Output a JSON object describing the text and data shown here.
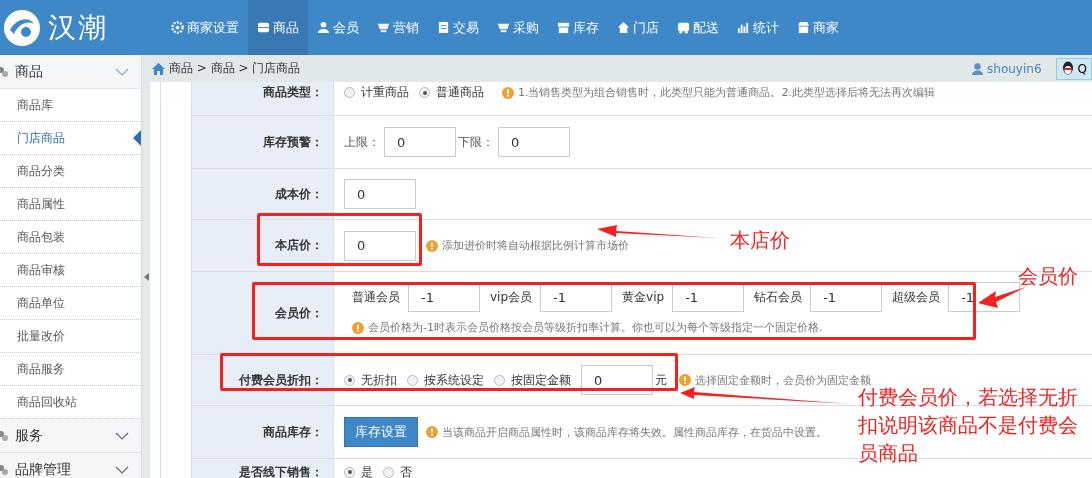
{
  "logo": {
    "text": "汉潮"
  },
  "nav": [
    {
      "label": "商家设置",
      "selected": false
    },
    {
      "label": "商品",
      "selected": true
    },
    {
      "label": "会员",
      "selected": false
    },
    {
      "label": "营销",
      "selected": false
    },
    {
      "label": "交易",
      "selected": false
    },
    {
      "label": "采购",
      "selected": false
    },
    {
      "label": "库存",
      "selected": false
    },
    {
      "label": "门店",
      "selected": false
    },
    {
      "label": "配送",
      "selected": false
    },
    {
      "label": "统计",
      "selected": false
    },
    {
      "label": "商家",
      "selected": false
    }
  ],
  "breadcrumb": "商品 > 商品 > 门店商品",
  "user": {
    "name": "shouyin6",
    "qq": "Q"
  },
  "sidebar": [
    {
      "label": "商品",
      "expanded": true,
      "items": [
        {
          "label": "商品库",
          "selected": false
        },
        {
          "label": "门店商品",
          "selected": true
        },
        {
          "label": "商品分类",
          "selected": false
        },
        {
          "label": "商品属性",
          "selected": false
        },
        {
          "label": "商品包装",
          "selected": false
        },
        {
          "label": "商品审核",
          "selected": false
        },
        {
          "label": "商品单位",
          "selected": false
        },
        {
          "label": "批量改价",
          "selected": false
        },
        {
          "label": "商品服务",
          "selected": false
        },
        {
          "label": "商品回收站",
          "selected": false
        }
      ]
    },
    {
      "label": "服务",
      "expanded": false
    },
    {
      "label": "品牌管理",
      "expanded": false
    }
  ],
  "form": [
    {
      "label": "商品类型：",
      "controls": [
        {
          "kind": "radio",
          "label": "计重商品",
          "checked": false
        },
        {
          "kind": "radio",
          "label": "普通商品",
          "checked": true
        }
      ],
      "hint": "1.当销售类型为组合销售时，此类型只能为普通商品。2.此类型选择后将无法再次编辑"
    },
    {
      "label": "库存预警：",
      "controls": [
        {
          "kind": "text",
          "label": "上限："
        },
        {
          "kind": "input",
          "value": "0"
        },
        {
          "kind": "text",
          "label": "下限："
        },
        {
          "kind": "input",
          "value": "0"
        }
      ]
    },
    {
      "label": "成本价：",
      "controls": [
        {
          "kind": "input",
          "value": "0"
        }
      ]
    },
    {
      "label": "本店价：",
      "controls": [
        {
          "kind": "input",
          "value": "0"
        }
      ],
      "hint": "添加进价时将自动根据比例计算市场价"
    },
    {
      "label": "会员价：",
      "controls": [
        {
          "kind": "text",
          "label": "普通会员"
        },
        {
          "kind": "input",
          "value": "-1"
        },
        {
          "kind": "text",
          "label": "vip会员"
        },
        {
          "kind": "input",
          "value": "-1"
        },
        {
          "kind": "text",
          "label": "黄金vip"
        },
        {
          "kind": "input",
          "value": "-1"
        },
        {
          "kind": "text",
          "label": "钻石会员"
        },
        {
          "kind": "input",
          "value": "-1"
        },
        {
          "kind": "text",
          "label": "超级会员"
        },
        {
          "kind": "input",
          "value": "-1"
        }
      ],
      "note": "会员价格为-1时表示会员价格按会员等级折扣率计算。你也可以为每个等级指定一个固定价格."
    },
    {
      "label": "付费会员折扣：",
      "controls": [
        {
          "kind": "radio",
          "label": "无折扣",
          "checked": true
        },
        {
          "kind": "radio",
          "label": "按系统设定",
          "checked": false
        },
        {
          "kind": "radio",
          "label": "按固定金额",
          "checked": false
        },
        {
          "kind": "input",
          "value": "0"
        },
        {
          "kind": "text",
          "label": "元"
        }
      ],
      "hint": "选择固定金额时，会员价为固定金额"
    },
    {
      "label": "商品库存：",
      "controls": [
        {
          "kind": "button",
          "label": "库存设置"
        }
      ],
      "hint": "当该商品开启商品属性时，该商品库存将失效。属性商品库存，在货品中设置。"
    },
    {
      "label": "是否线下销售：",
      "controls": [
        {
          "kind": "radio",
          "label": "是",
          "checked": true
        },
        {
          "kind": "radio",
          "label": "否",
          "checked": false
        }
      ]
    }
  ],
  "annotations": [
    "本店价",
    "会员价",
    "付费会员价，若选择无折扣说明该商品不是付费会员商品"
  ]
}
